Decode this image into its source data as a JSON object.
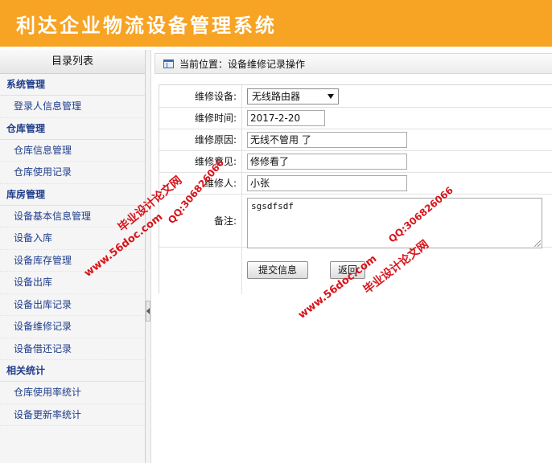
{
  "app": {
    "title": "利达企业物流设备管理系统"
  },
  "sidebar": {
    "heading": "目录列表",
    "groups": [
      {
        "label": "系统管理",
        "items": [
          "登录人信息管理"
        ]
      },
      {
        "label": "仓库管理",
        "items": [
          "仓库信息管理",
          "仓库使用记录"
        ]
      },
      {
        "label": "库房管理",
        "items": [
          "设备基本信息管理",
          "设备入库",
          "设备库存管理",
          "设备出库",
          "设备出库记录",
          "设备维修记录",
          "设备借还记录"
        ]
      },
      {
        "label": "相关统计",
        "items": [
          "仓库使用率统计",
          "设备更新率统计"
        ]
      }
    ]
  },
  "breadcrumb": {
    "text": "当前位置：设备维修记录操作"
  },
  "form": {
    "device": {
      "label": "维修设备:",
      "value": "无线路由器"
    },
    "time": {
      "label": "维修时间:",
      "value": "2017-2-20"
    },
    "reason": {
      "label": "维修原因:",
      "value": "无线不管用 了"
    },
    "opinion": {
      "label": "维修意见:",
      "value": "修修看了"
    },
    "person": {
      "label": "维修人:",
      "value": "小张"
    },
    "remark": {
      "label": "备注:",
      "value": "sgsdfsdf"
    },
    "submit_label": "提交信息",
    "back_label": "返回"
  },
  "watermarks": {
    "site": "www.56doc.com",
    "name": "毕业设计论文网",
    "qq": "QQ:306826066"
  }
}
